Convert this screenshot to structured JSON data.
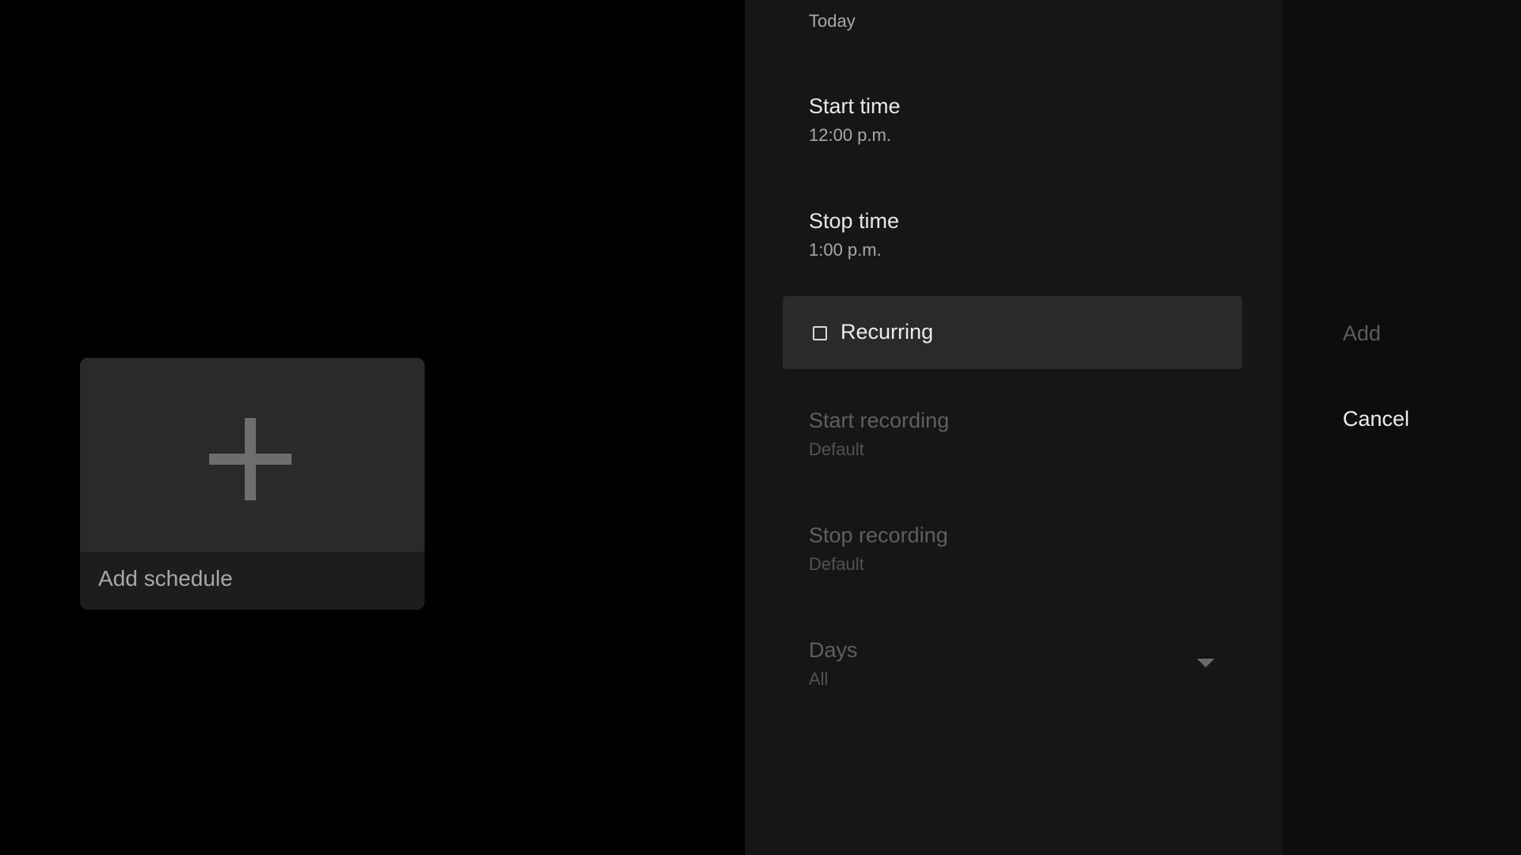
{
  "left": {
    "card": {
      "label": "Add schedule",
      "icon": "plus-icon"
    }
  },
  "settings": {
    "date_value": "Today",
    "start_time": {
      "label": "Start time",
      "value": "12:00 p.m."
    },
    "stop_time": {
      "label": "Stop time",
      "value": "1:00 p.m."
    },
    "recurring": {
      "label": "Recurring",
      "checked": false
    },
    "start_recording": {
      "label": "Start recording",
      "value": "Default"
    },
    "stop_recording": {
      "label": "Stop recording",
      "value": "Default"
    },
    "days": {
      "label": "Days",
      "value": "All",
      "icon": "chevron-down-icon"
    }
  },
  "actions": {
    "add_label": "Add",
    "cancel_label": "Cancel"
  }
}
